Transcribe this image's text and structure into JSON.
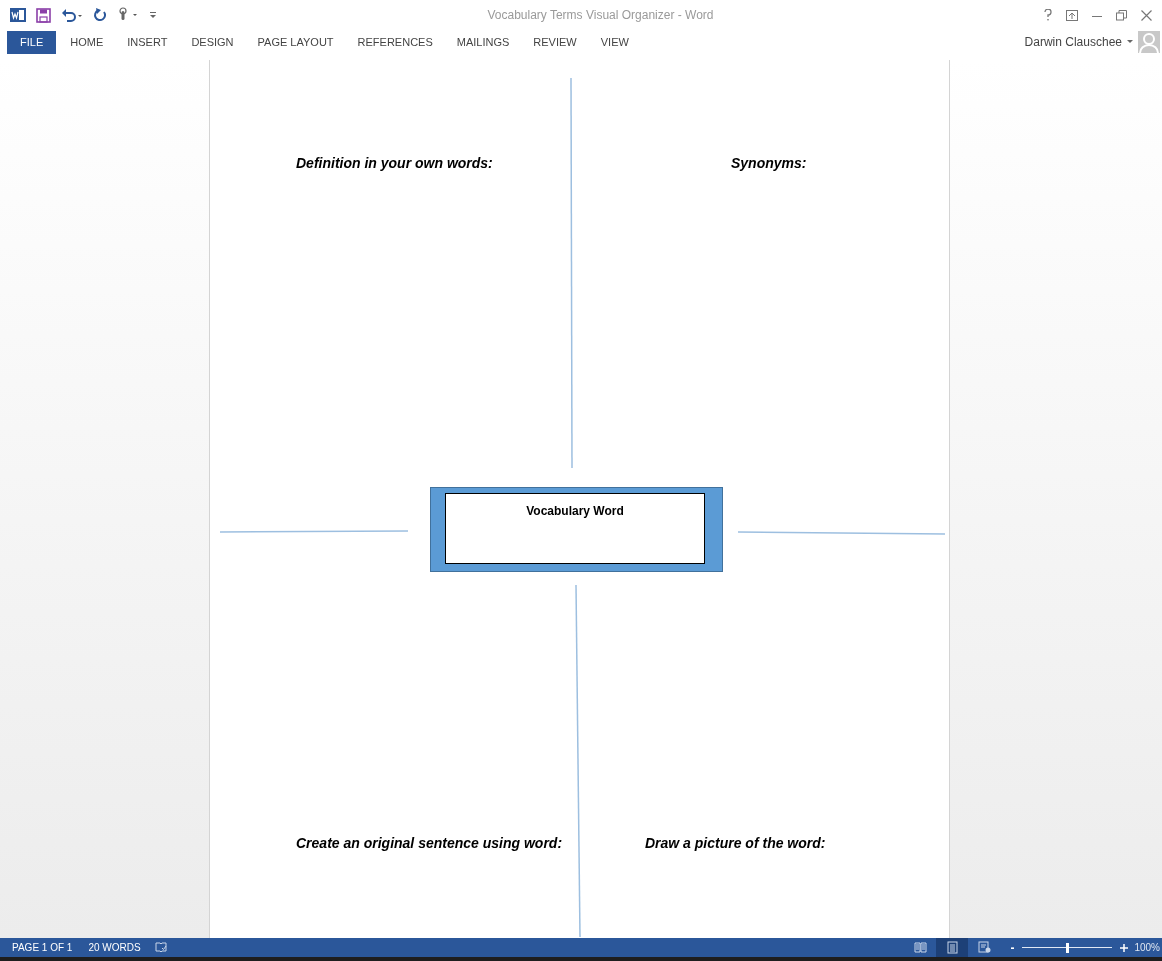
{
  "window": {
    "title": "Vocabulary Terms Visual Organizer - Word",
    "user": "Darwin Clauschee"
  },
  "ribbon_tabs": [
    {
      "label": "FILE",
      "selected": true
    },
    {
      "label": "HOME",
      "selected": false
    },
    {
      "label": "INSERT",
      "selected": false
    },
    {
      "label": "DESIGN",
      "selected": false
    },
    {
      "label": "PAGE LAYOUT",
      "selected": false
    },
    {
      "label": "REFERENCES",
      "selected": false
    },
    {
      "label": "MAILINGS",
      "selected": false
    },
    {
      "label": "REVIEW",
      "selected": false
    },
    {
      "label": "VIEW",
      "selected": false
    }
  ],
  "document": {
    "center_box": "Vocabulary Word",
    "quadrants": [
      {
        "heading": "Definition in your own words:"
      },
      {
        "heading": "Synonyms:"
      },
      {
        "heading": "Create an original sentence using word:"
      },
      {
        "heading": "Draw a picture of the word:"
      }
    ]
  },
  "status_bar": {
    "page": "PAGE 1 OF 1",
    "words": "20 WORDS",
    "views": [
      {
        "kind": "read",
        "selected": false
      },
      {
        "kind": "print",
        "selected": true
      },
      {
        "kind": "web",
        "selected": false
      }
    ],
    "zoom": {
      "out": "-",
      "level": 0.5,
      "reading": "100%"
    }
  }
}
